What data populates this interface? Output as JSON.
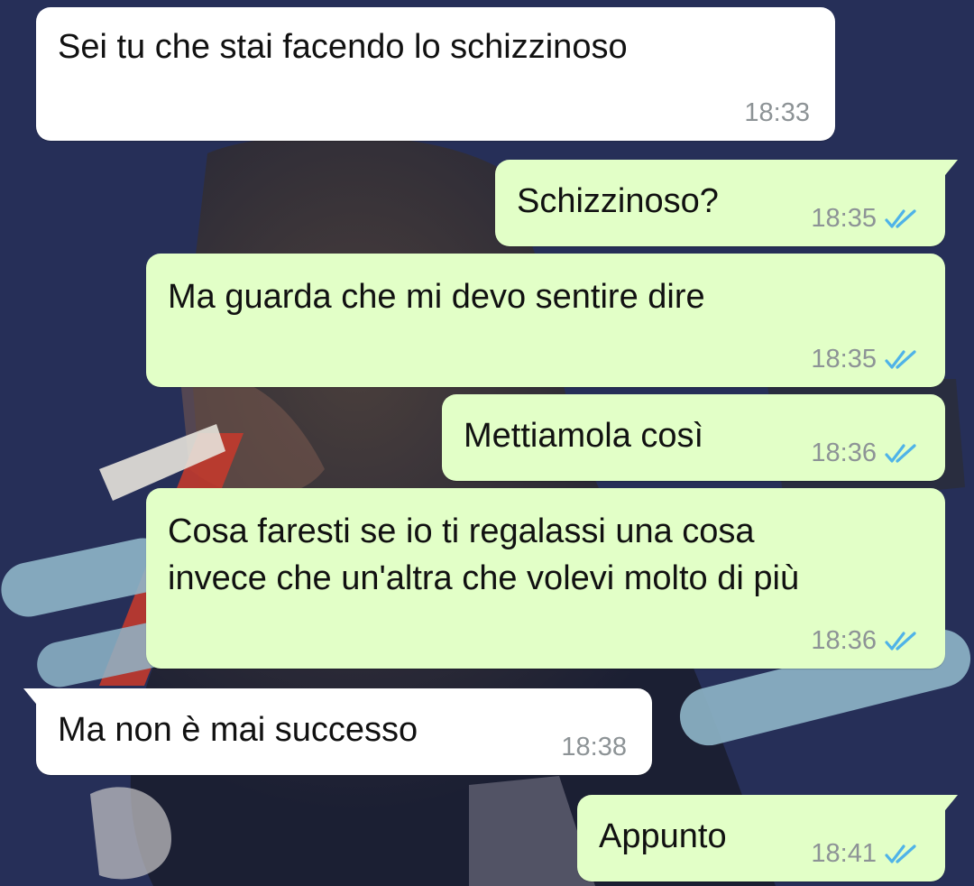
{
  "chat": {
    "messages": [
      {
        "text": "Sei tu che stai facendo lo schizzinoso",
        "time": "18:33",
        "direction": "incoming"
      },
      {
        "text": "Schizzinoso?",
        "time": "18:35",
        "direction": "outgoing",
        "status": "read"
      },
      {
        "text": "Ma guarda che mi devo sentire dire",
        "time": "18:35",
        "direction": "outgoing",
        "status": "read"
      },
      {
        "text": "Mettiamola così",
        "time": "18:36",
        "direction": "outgoing",
        "status": "read"
      },
      {
        "text": "Cosa faresti se io ti regalassi una cosa\ninvece che un'altra che volevi molto di più",
        "time": "18:36",
        "direction": "outgoing",
        "status": "read"
      },
      {
        "text": "Ma non è mai successo",
        "time": "18:38",
        "direction": "incoming"
      },
      {
        "text": "Appunto",
        "time": "18:41",
        "direction": "outgoing",
        "status": "read"
      }
    ]
  },
  "colors": {
    "incoming_bubble": "#ffffff",
    "outgoing_bubble": "#e2ffc7",
    "read_tick": "#4fb3e8",
    "timestamp": "#8d9396",
    "wallpaper": "#232d55"
  },
  "icons": {
    "read_receipt": "double-check-icon"
  }
}
